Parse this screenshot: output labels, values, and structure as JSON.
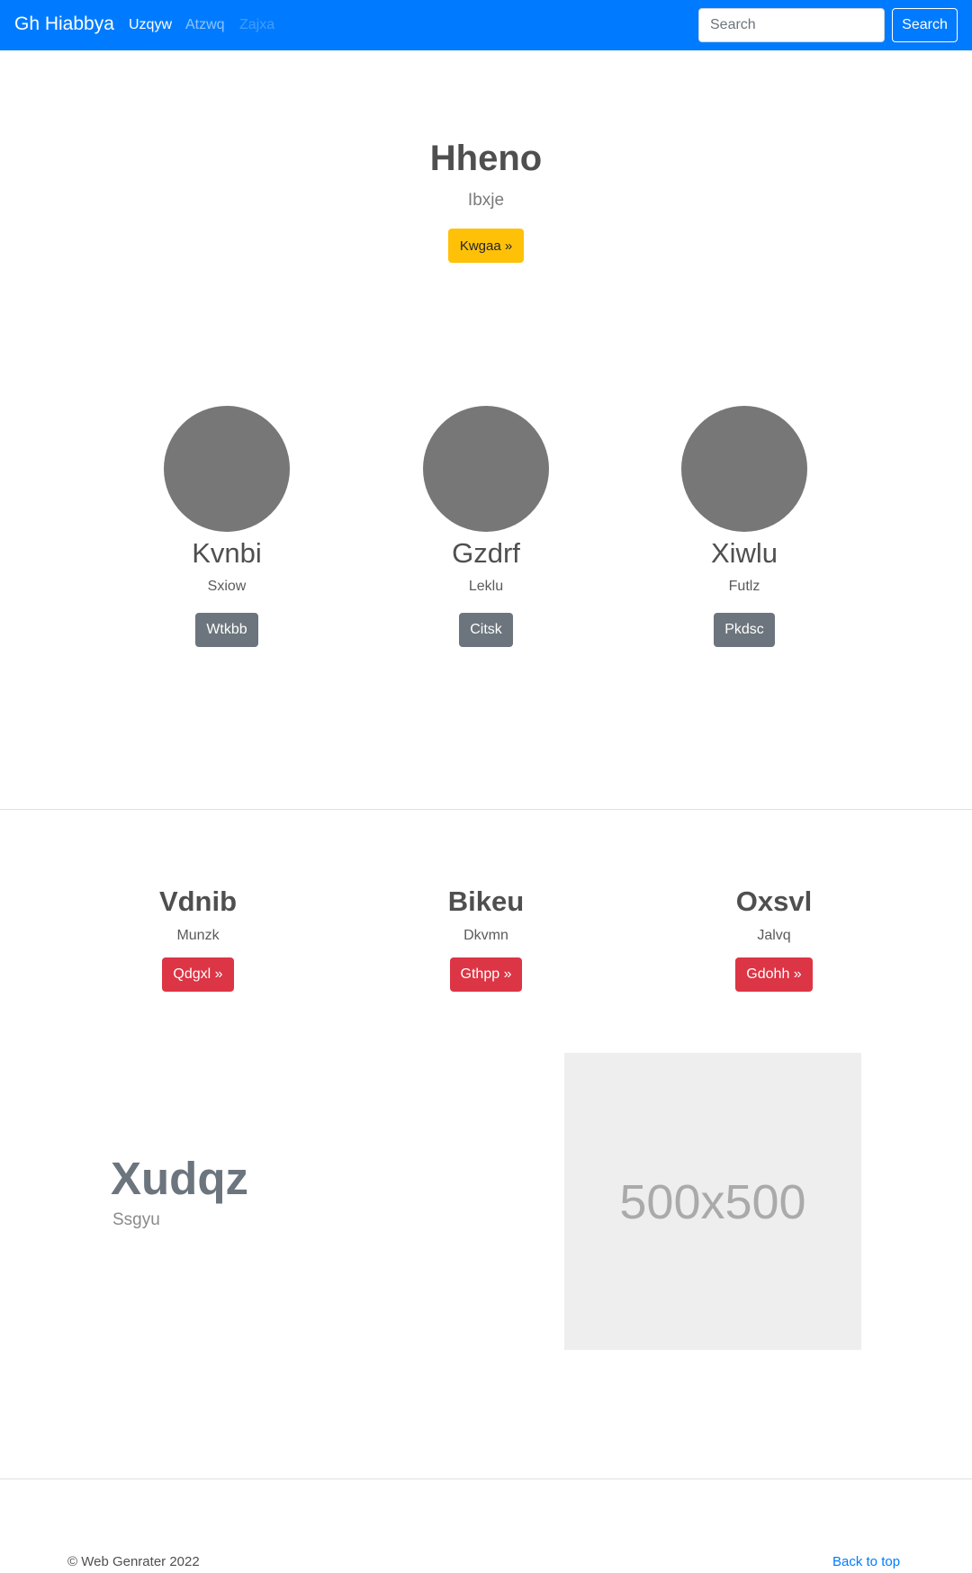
{
  "navbar": {
    "brand": "Gh Hiabbya",
    "links": [
      "Uzqyw",
      "Atzwq",
      "Zajxa"
    ],
    "search_placeholder": "Search",
    "search_button": "Search",
    "color": "#007bff"
  },
  "hero": {
    "title": "Hheno",
    "subtitle": "Ibxje",
    "button": "Kwgaa »",
    "button_color": "#ffc107"
  },
  "circles": [
    {
      "title": "Kvnbi",
      "subtitle": "Sxiow",
      "button": "Wtkbb"
    },
    {
      "title": "Gzdrf",
      "subtitle": "Leklu",
      "button": "Citsk"
    },
    {
      "title": "Xiwlu",
      "subtitle": "Futlz",
      "button": "Pkdsc"
    }
  ],
  "features": [
    {
      "title": "Vdnib",
      "subtitle": "Munzk",
      "button": "Qdgxl »"
    },
    {
      "title": "Bikeu",
      "subtitle": "Dkvmn",
      "button": "Gthpp »"
    },
    {
      "title": "Oxsvl",
      "subtitle": "Jalvq",
      "button": "Gdohh »"
    }
  ],
  "featurette": {
    "title": "Xudqz",
    "subtitle": "Ssgyu",
    "image_label": "500x500"
  },
  "footer": {
    "copyright": "© Web Genrater 2022",
    "back_to_top": "Back to top"
  }
}
